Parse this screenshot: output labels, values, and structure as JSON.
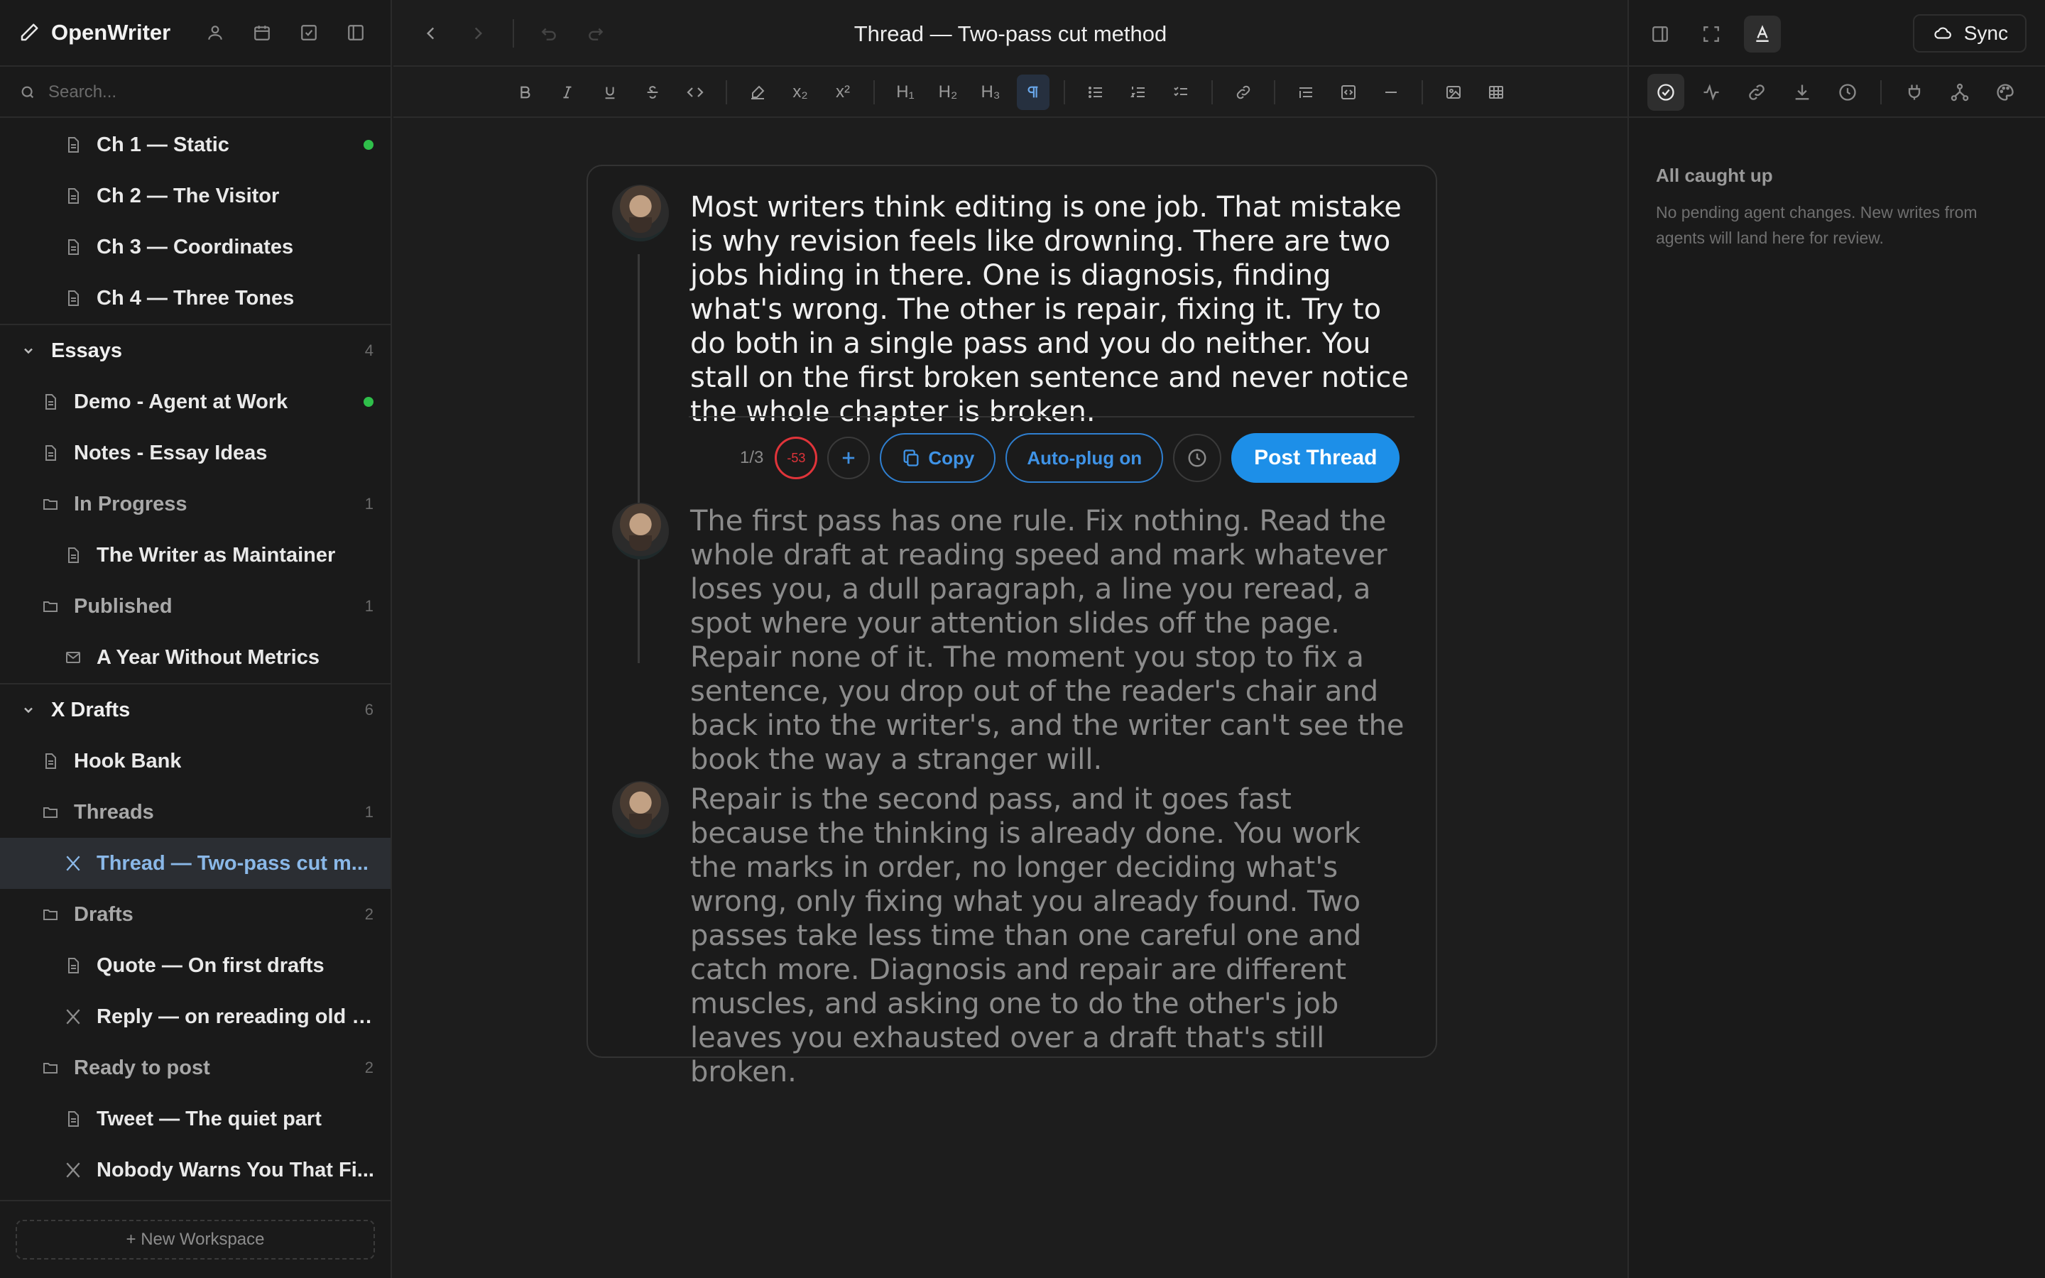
{
  "app": {
    "name": "OpenWriter"
  },
  "search": {
    "placeholder": "Search..."
  },
  "doc": {
    "title": "Thread — Two-pass cut method"
  },
  "tree": {
    "chapters": [
      {
        "label": "Ch 1 — Static",
        "modified": true
      },
      {
        "label": "Ch 2 — The Visitor"
      },
      {
        "label": "Ch 3 — Coordinates"
      },
      {
        "label": "Ch 4 — Three Tones"
      }
    ],
    "essays": {
      "label": "Essays",
      "count": "4",
      "items": [
        {
          "label": "Demo - Agent at Work",
          "modified": true
        },
        {
          "label": "Notes - Essay Ideas"
        }
      ],
      "in_progress": {
        "label": "In Progress",
        "count": "1",
        "items": [
          {
            "label": "The Writer as Maintainer"
          }
        ]
      },
      "published": {
        "label": "Published",
        "count": "1",
        "items": [
          {
            "label": "A Year Without Metrics"
          }
        ]
      }
    },
    "x_drafts": {
      "label": "X Drafts",
      "count": "6",
      "hook_bank": "Hook Bank",
      "threads": {
        "label": "Threads",
        "count": "1",
        "items": [
          {
            "label": "Thread — Two-pass cut m..."
          }
        ]
      },
      "drafts": {
        "label": "Drafts",
        "count": "2",
        "items": [
          {
            "label": "Quote — On first drafts"
          },
          {
            "label": "Reply — on rereading old d..."
          }
        ]
      },
      "ready": {
        "label": "Ready to post",
        "count": "2",
        "items": [
          {
            "label": "Tweet — The quiet part"
          },
          {
            "label": "Nobody Warns You That Fi..."
          }
        ]
      }
    }
  },
  "footer": {
    "new_workspace": "+ New Workspace"
  },
  "toolbar": {
    "sub": "x₂",
    "sup": "x²",
    "h1": "H₁",
    "h2": "H₂",
    "h3": "H₃"
  },
  "thread": {
    "posts": [
      {
        "text": "Most writers think editing is one job. That mistake is why revision feels like drowning. There are two jobs hiding in there. One is diagnosis, finding what's wrong. The other is repair, fixing it. Try to do both in a single pass and you do neither. You stall on the first broken sentence and never notice the whole chapter is broken."
      },
      {
        "text": "The first pass has one rule. Fix nothing. Read the whole draft at reading speed and mark whatever loses you, a dull paragraph, a line you reread, a spot where your attention slides off the page. Repair none of it. The moment you stop to fix a sentence, you drop out of the reader's chair and back into the writer's, and the writer can't see the book the way a stranger will."
      },
      {
        "text": "Repair is the second pass, and it goes fast because the thinking is already done. You work the marks in order, no longer deciding what's wrong, only fixing what you already found. Two passes take less time than one careful one and catch more. Diagnosis and repair are different muscles, and asking one to do the other's job leaves you exhausted over a draft that's still broken."
      }
    ],
    "position": "1/3",
    "char_remaining": "-53",
    "copy_label": "Copy",
    "autoplug_label": "Auto-plug on",
    "post_label": "Post Thread"
  },
  "right_panel": {
    "sync_label": "Sync",
    "heading": "All caught up",
    "message": "No pending agent changes. New writes from agents will land here for review."
  },
  "colors": {
    "accent": "#1d8fe8",
    "danger": "#e0343a",
    "modified_dot": "#2fbf4a"
  }
}
